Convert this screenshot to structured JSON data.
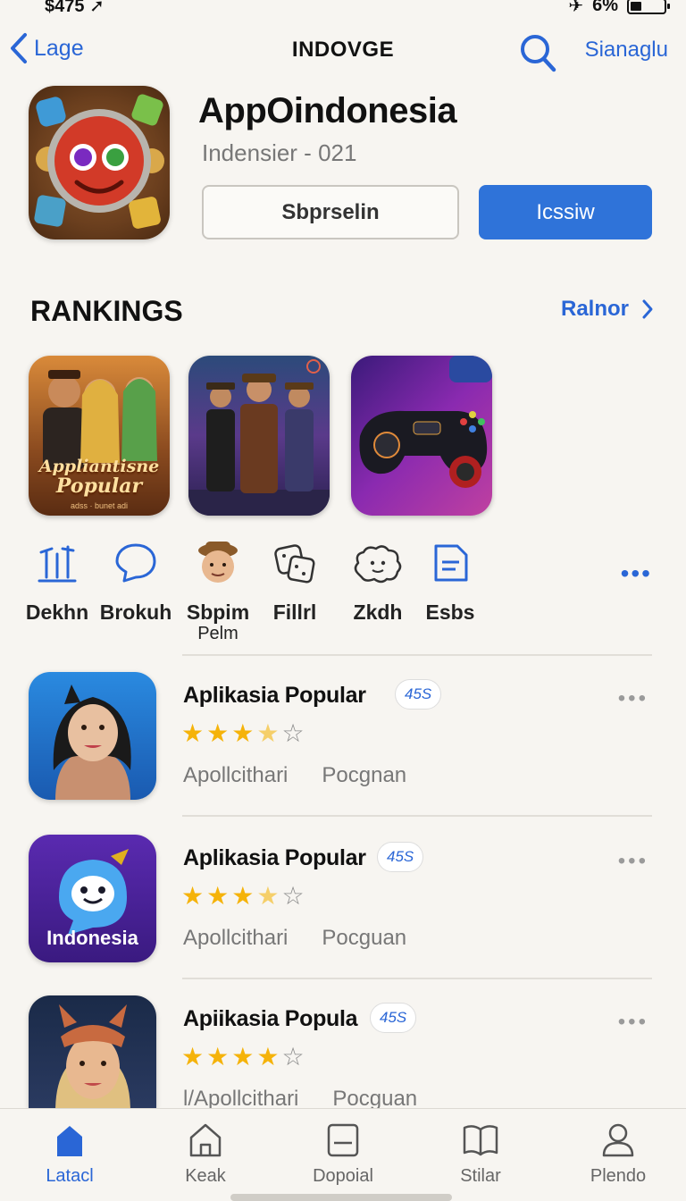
{
  "status_bar": {
    "left_text": "$475",
    "right_text": "6%"
  },
  "nav": {
    "back_label": "Lage",
    "title": "INDOVGE",
    "right_label": "Sianaglu"
  },
  "app": {
    "name": "AppOindonesia",
    "subtitle": "Indensier - 021",
    "secondary_button": "Sbprselin",
    "primary_button": "Icssiw"
  },
  "rankings": {
    "title": "RANKINGS",
    "link_label": "Ralnor",
    "tiles": [
      {
        "text_line1": "Appliantisne",
        "text_line2": "Popular",
        "caption": "adss · bunet adi"
      },
      {
        "text_line1": "",
        "text_line2": "",
        "caption": ""
      },
      {
        "text_line1": "",
        "text_line2": "",
        "caption": ""
      }
    ]
  },
  "categories": [
    {
      "label": "Dekhn",
      "sub": "",
      "icon": "chart-icon"
    },
    {
      "label": "Brokuh",
      "sub": "",
      "icon": "chat-bubble-icon"
    },
    {
      "label": "Sbpim",
      "sub": "Pelm",
      "icon": "avatar-icon"
    },
    {
      "label": "Fillrl",
      "sub": "",
      "icon": "dice-icon"
    },
    {
      "label": "Zkdh",
      "sub": "",
      "icon": "puzzle-icon"
    },
    {
      "label": "Esbs",
      "sub": "",
      "icon": "document-icon"
    }
  ],
  "list": [
    {
      "title": "Aplikasia Popular",
      "badge": "45S",
      "rating": 3.5,
      "meta1": "Apollcithari",
      "meta2": "Pocgnan",
      "icon_text": ""
    },
    {
      "title": "Aplikasia Popular",
      "badge": "45S",
      "rating": 3.5,
      "meta1": "Apollcithari",
      "meta2": "Pocguan",
      "icon_text": "Indonesia"
    },
    {
      "title": "Apiikasia Popula",
      "badge": "45S",
      "rating": 4,
      "meta1": "l/Apollcithari",
      "meta2": "Pocguan",
      "icon_text": ""
    }
  ],
  "tabs": [
    {
      "label": "Latacl",
      "icon": "home-icon",
      "active": true
    },
    {
      "label": "Keak",
      "icon": "house-outline-icon",
      "active": false
    },
    {
      "label": "Dopoial",
      "icon": "tablet-icon",
      "active": false
    },
    {
      "label": "Stilar",
      "icon": "book-icon",
      "active": false
    },
    {
      "label": "Plendo",
      "icon": "profile-icon",
      "active": false
    }
  ],
  "colors": {
    "accent": "#2f73d9",
    "star": "#f5b30a",
    "background": "#f7f5f1"
  }
}
